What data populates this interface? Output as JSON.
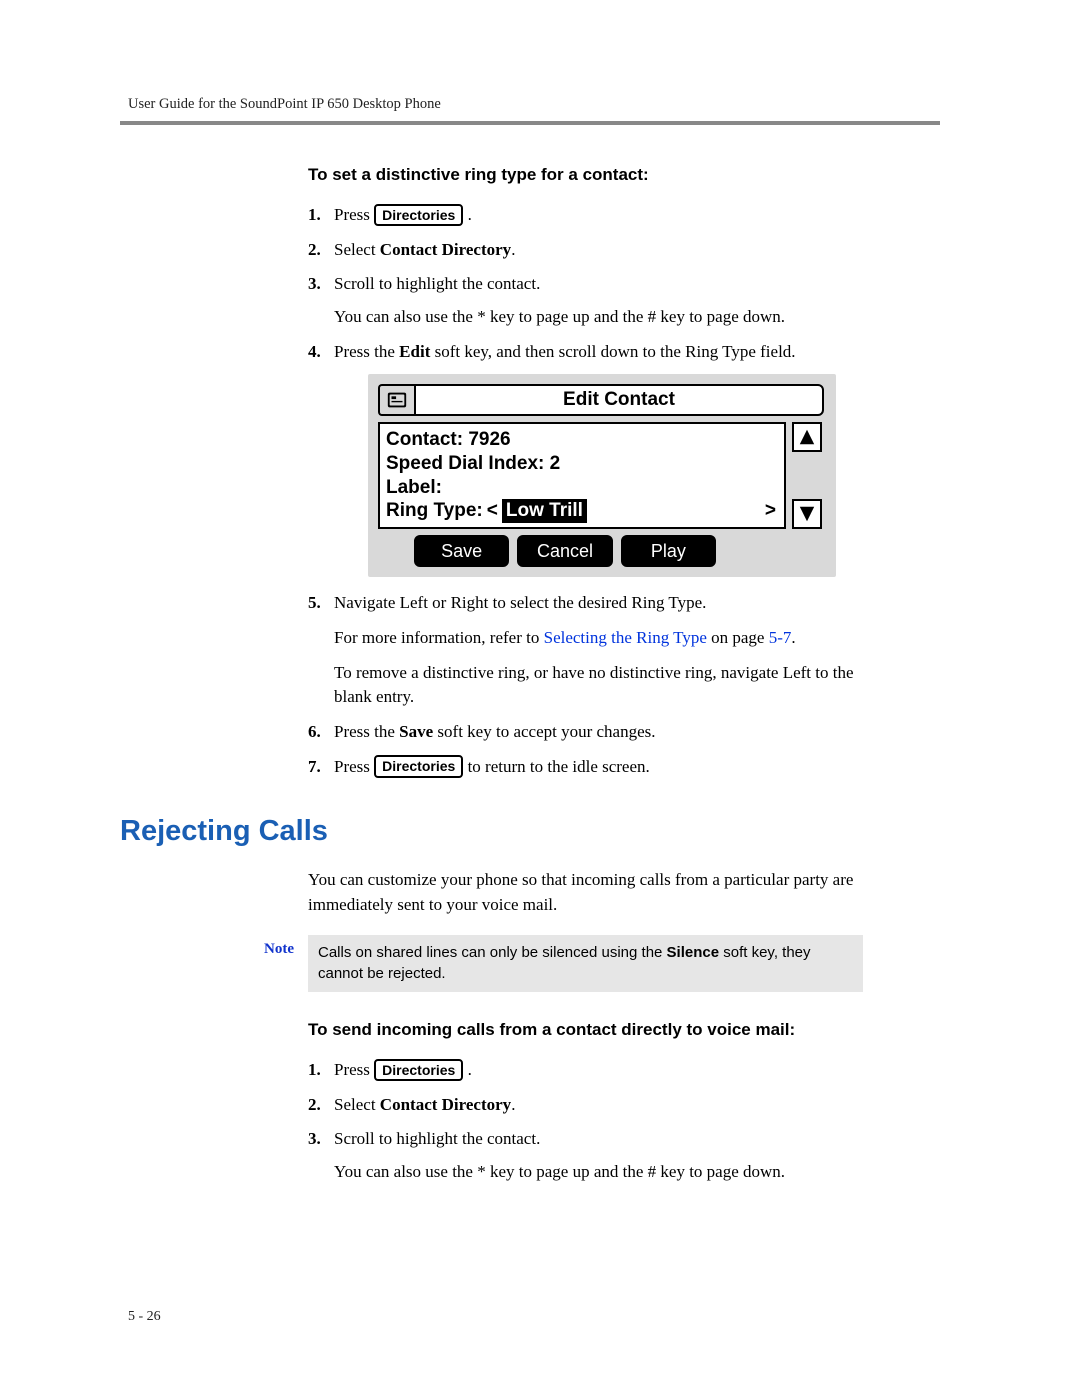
{
  "header": {
    "running_title": "User Guide for the SoundPoint IP 650 Desktop Phone"
  },
  "section1": {
    "subhead": "To set a distinctive ring type for a contact:",
    "steps": {
      "s1_pre": "Press ",
      "s1_post": " .",
      "dir_btn": "Directories",
      "s2_pre": "Select ",
      "s2_bold": "Contact Directory",
      "s2_post": ".",
      "s3": "Scroll to highlight the contact.",
      "s3b": "You can also use the * key to page up and the # key to page down.",
      "s4_a": "Press the ",
      "s4_b": "Edit",
      "s4_c": " soft key, and then scroll down to the Ring Type field.",
      "s5": "Navigate Left or Right to select the desired Ring Type.",
      "s5b_a": "For more information, refer to ",
      "s5b_link": "Selecting the Ring Type",
      "s5b_b": " on page ",
      "s5b_pg": "5-7",
      "s5b_c": ".",
      "s5c": "To remove a distinctive ring, or have no distinctive ring, navigate Left to the blank entry.",
      "s6_a": "Press the ",
      "s6_b": "Save",
      "s6_c": " soft key to accept your changes.",
      "s7_pre": "Press ",
      "s7_post": " to return to the idle screen."
    }
  },
  "lcd": {
    "title": "Edit Contact",
    "contact_label": "Contact:",
    "contact_value": "7926",
    "sdi_label": "Speed Dial Index:",
    "sdi_value": "2",
    "label_label": "Label:",
    "ring_label": "Ring Type:",
    "ring_value": "Low Trill",
    "softkeys": [
      "Save",
      "Cancel",
      "Play"
    ],
    "scroll_up": "⬆",
    "scroll_down": "⬇"
  },
  "section2": {
    "heading": "Rejecting Calls",
    "intro": "You can customize your phone so that incoming calls from a particular party are immediately sent to your voice mail.",
    "note_label": "Note",
    "note_a": "Calls on shared lines can only be silenced using the ",
    "note_b": "Silence",
    "note_c": " soft key, they cannot be rejected.",
    "subhead": "To send incoming calls from a contact directly to voice mail:",
    "steps": {
      "s1_pre": "Press ",
      "s1_post": " .",
      "dir_btn": "Directories",
      "s2_pre": "Select ",
      "s2_bold": "Contact Directory",
      "s2_post": ".",
      "s3": "Scroll to highlight the contact.",
      "s3b": "You can also use the * key to page up and the # key to page down."
    }
  },
  "footer": {
    "page_num": "5 - 26"
  }
}
